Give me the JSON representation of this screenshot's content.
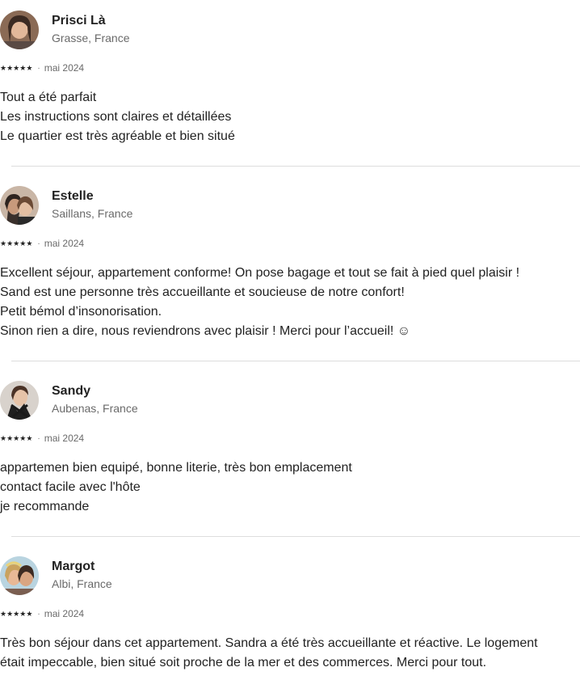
{
  "reviews": [
    {
      "name": "Prisci Là",
      "location": "Grasse, France",
      "stars": 5,
      "date": "mai 2024",
      "lines": [
        "Tout a été parfait",
        "Les instructions sont claires et détaillées",
        "Le quartier est très agréable et bien situé"
      ]
    },
    {
      "name": "Estelle",
      "location": "Saillans, France",
      "stars": 5,
      "date": "mai 2024",
      "lines": [
        "Excellent séjour, appartement conforme! On pose bagage et tout se fait à pied quel plaisir !",
        "Sand est une personne très accueillante et soucieuse de notre confort!",
        "Petit bémol d’insonorisation.",
        "Sinon rien a dire, nous reviendrons avec plaisir ! Merci pour l’accueil! ☺"
      ]
    },
    {
      "name": "Sandy",
      "location": "Aubenas, France",
      "stars": 5,
      "date": "mai 2024",
      "lines": [
        "appartemen bien equipé, bonne literie, très bon emplacement",
        "contact facile avec l'hôte",
        "je recommande"
      ]
    },
    {
      "name": "Margot",
      "location": "Albi, France",
      "stars": 5,
      "date": "mai 2024",
      "lines": [
        "Très bon séjour dans cet appartement. Sandra a été très accueillante et réactive. Le logement était impeccable, bien situé soit proche de la mer et des commerces. Merci pour tout."
      ]
    }
  ],
  "meta_separator": "·",
  "star_glyph": "★"
}
